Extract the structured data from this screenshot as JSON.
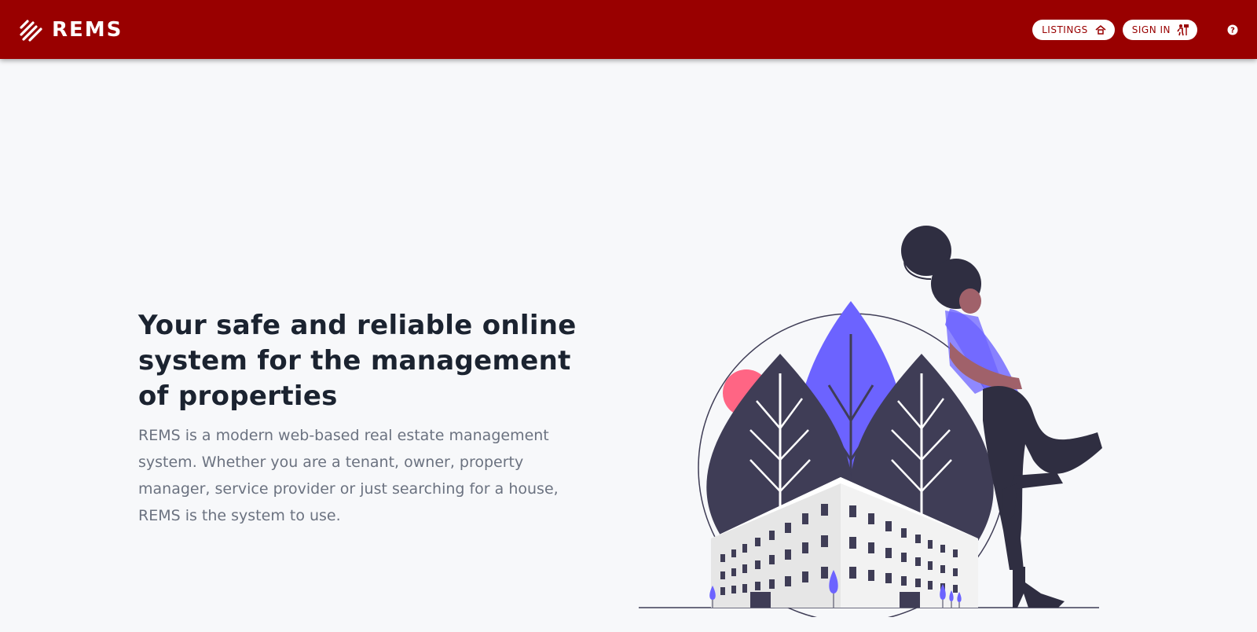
{
  "navbar": {
    "brand": "REMS",
    "listings_label": "LISTINGS",
    "signin_label": "SIGN IN",
    "background": "#990000"
  },
  "hero": {
    "title": "Your safe and reliable online system for the management of properties",
    "description": "REMS is a modern web-based real estate management system. Whether you are a tenant, owner, property manager, service provider or just searching for a house, REMS is the system to use."
  },
  "icons": [
    "logo-icon",
    "house-icon",
    "sign-in-icon",
    "help-icon"
  ],
  "colors": {
    "title": "#1b2330",
    "text": "#6b7280",
    "accent": "#6c63ff",
    "dark": "#3f3d56",
    "pink": "#ff6584"
  }
}
